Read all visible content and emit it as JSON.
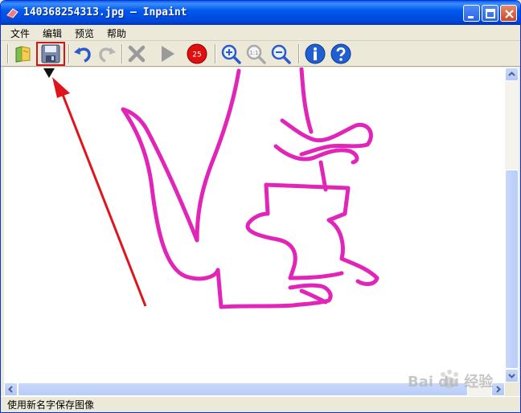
{
  "window": {
    "title": "140368254313.jpg — Inpaint"
  },
  "menu": {
    "items": [
      "文件",
      "编辑",
      "预览",
      "帮助"
    ]
  },
  "toolbar": {
    "buttons": [
      {
        "name": "open-icon"
      },
      {
        "name": "save-icon",
        "highlighted": true
      },
      {
        "name": "undo-icon"
      },
      {
        "name": "redo-icon"
      },
      {
        "name": "delete-icon"
      },
      {
        "name": "run-icon"
      },
      {
        "name": "brush-size-icon",
        "label": "25"
      },
      {
        "name": "zoom-in-icon"
      },
      {
        "name": "zoom-actual-icon",
        "label": "1:1"
      },
      {
        "name": "zoom-out-icon"
      },
      {
        "name": "info-icon"
      },
      {
        "name": "help-icon"
      }
    ]
  },
  "status": {
    "text": "使用新名字保存图像"
  },
  "watermark": {
    "text": "Bai du 经验"
  },
  "colors": {
    "drawing": "#e01ab5",
    "annotation_arrow": "#e0151b",
    "titlebar": "#0058ee"
  }
}
